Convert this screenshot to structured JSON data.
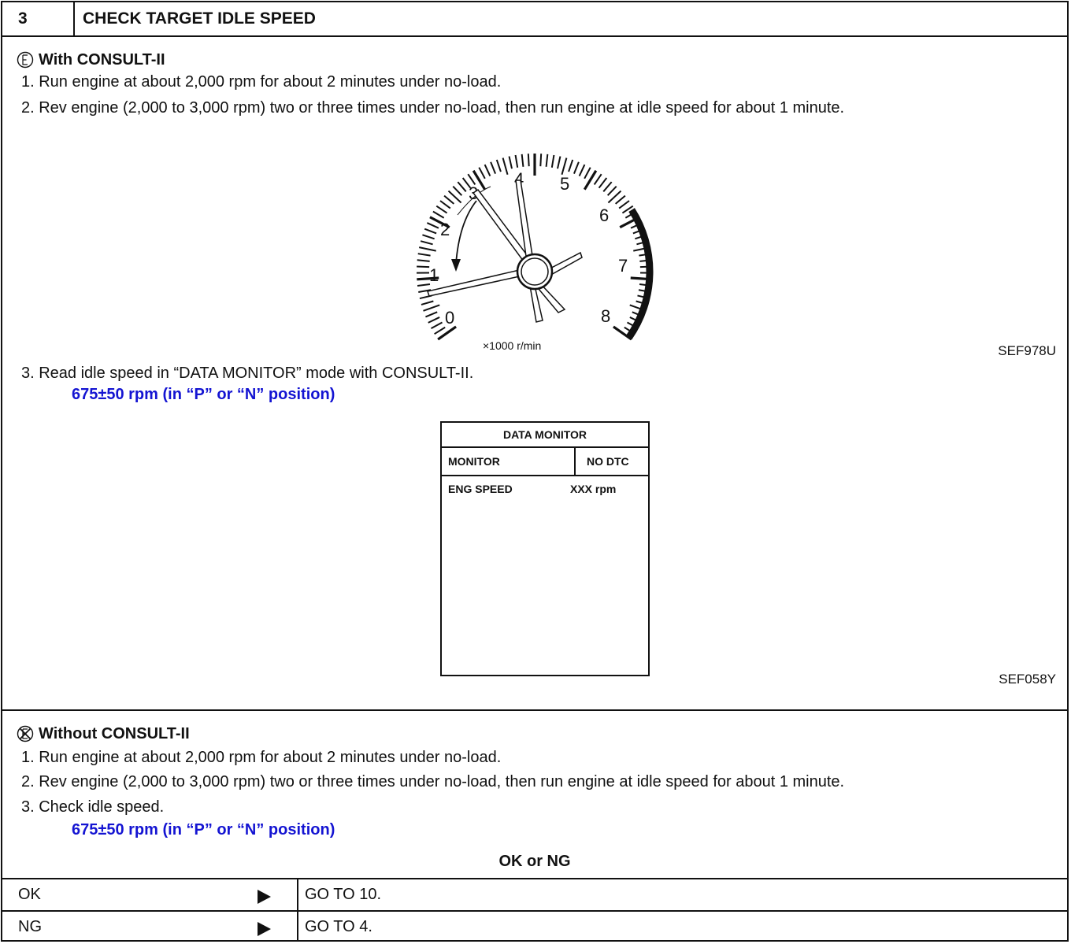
{
  "header": {
    "step_number": "3",
    "title": "CHECK TARGET IDLE SPEED"
  },
  "with_consult": {
    "heading": "With CONSULT-II",
    "steps": [
      "1. Run engine at about 2,000 rpm for about 2 minutes under no-load.",
      "2. Rev engine (2,000 to 3,000 rpm) two or three times under no-load, then run engine at idle speed for about 1 minute."
    ],
    "step3": "3. Read idle speed in “DATA MONITOR” mode with CONSULT-II.",
    "spec": "675±50 rpm (in “P” or “N” position)"
  },
  "gauge": {
    "unit_label": "×1000 r/min",
    "numbers": [
      "0",
      "1",
      "2",
      "3",
      "4",
      "5",
      "6",
      "7",
      "8"
    ],
    "figure_code": "SEF978U"
  },
  "data_monitor": {
    "title": "DATA MONITOR",
    "col1": "MONITOR",
    "col2": "NO DTC",
    "item_name": "ENG SPEED",
    "item_value": "XXX rpm",
    "figure_code": "SEF058Y"
  },
  "without_consult": {
    "heading": "Without CONSULT-II",
    "steps": [
      "1. Run engine at about 2,000 rpm for about 2 minutes under no-load.",
      "2. Rev engine (2,000 to 3,000 rpm) two or three times under no-load, then run engine at idle speed for about 1 minute.",
      "3. Check idle speed."
    ],
    "spec": "675±50 rpm (in “P” or “N” position)"
  },
  "result": {
    "heading": "OK or NG",
    "rows": [
      {
        "label": "OK",
        "dest": "GO TO 10."
      },
      {
        "label": "NG",
        "dest": "GO TO 4."
      }
    ]
  }
}
